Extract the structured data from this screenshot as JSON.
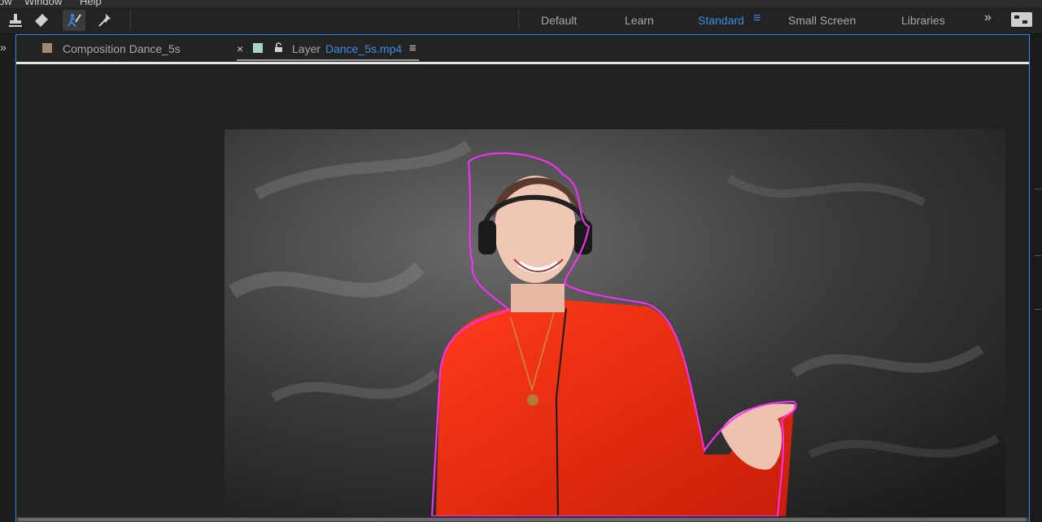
{
  "menu": {
    "items": [
      "ow",
      "Window",
      "Help"
    ]
  },
  "tools": [
    {
      "name": "clone-stamp-tool-icon"
    },
    {
      "name": "eraser-tool-icon"
    },
    {
      "name": "roto-brush-tool-icon",
      "active": true
    },
    {
      "name": "puppet-pin-tool-icon"
    }
  ],
  "workspaces": {
    "items": [
      "Default",
      "Learn",
      "Standard",
      "Small Screen",
      "Libraries"
    ],
    "active": "Standard",
    "menu_glyph": "≡",
    "more_glyph": "»"
  },
  "panel": {
    "left_chevron": "»",
    "tab_composition": "Composition Dance_5s",
    "tab_close": "×",
    "tab_layer_prefix": "Layer",
    "tab_layer_name": "Dance_5s.mp4",
    "tab_menu": "≡",
    "lock_glyph": "🔓"
  },
  "colors": {
    "accent": "#2d8ceb",
    "composition_swatch": "#a08a6e",
    "layer_swatch": "#a9d3cf",
    "roto_outline": "#ff2cff"
  }
}
